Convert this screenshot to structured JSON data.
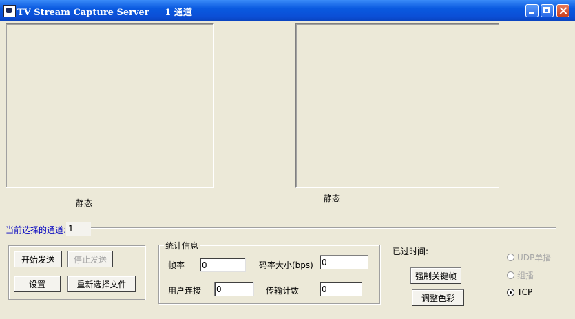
{
  "window": {
    "title": "TV Stream Capture Server     1 通道",
    "icon": "tv-app-icon"
  },
  "preview": {
    "left_status": "静态",
    "right_status": "静态"
  },
  "channel": {
    "label": "当前选择的通道:",
    "value": "1"
  },
  "controls": {
    "start_send": "开始发送",
    "stop_send": "停止发送",
    "settings": "设置",
    "reselect_file": "重新选择文件"
  },
  "stats": {
    "title": "统计信息",
    "frame_rate_label": "帧率",
    "frame_rate_value": "0",
    "bitrate_label": "码率大小(bps)",
    "bitrate_value": "0",
    "user_conn_label": "用户连接",
    "user_conn_value": "0",
    "transfer_count_label": "传输计数",
    "transfer_count_value": "0"
  },
  "elapsed": {
    "label": "已过时间:"
  },
  "actions": {
    "force_keyframe": "强制关键帧",
    "adjust_color": "调整色彩"
  },
  "transport": {
    "options": [
      "UDP单播",
      "组播",
      "TCP"
    ],
    "selected": "TCP"
  }
}
